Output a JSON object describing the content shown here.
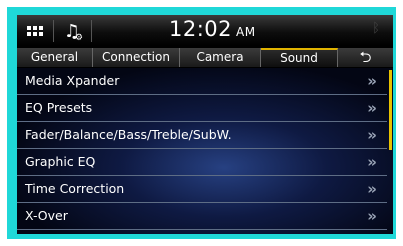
{
  "statusbar": {
    "time": "12:02",
    "ampm": "AM",
    "icons": [
      "grid-menu-icon",
      "music-settings-icon",
      "bluetooth-icon"
    ]
  },
  "tabs": [
    {
      "label": "General",
      "active": false
    },
    {
      "label": "Connection",
      "active": false
    },
    {
      "label": "Camera",
      "active": false
    },
    {
      "label": "Sound",
      "active": true
    },
    {
      "label": "⮌",
      "icon": "back-arrow-icon"
    }
  ],
  "list": {
    "items": [
      {
        "label": "Media Xpander"
      },
      {
        "label": "EQ Presets"
      },
      {
        "label": "Fader/Balance/Bass/Treble/SubW."
      },
      {
        "label": "Graphic EQ"
      },
      {
        "label": "Time Correction"
      },
      {
        "label": "X-Over"
      }
    ],
    "chevron": "»"
  },
  "colors": {
    "frame": "#1fd8d8",
    "active_tab_accent": "#e0b300",
    "scrollbar": "#e8c300"
  }
}
